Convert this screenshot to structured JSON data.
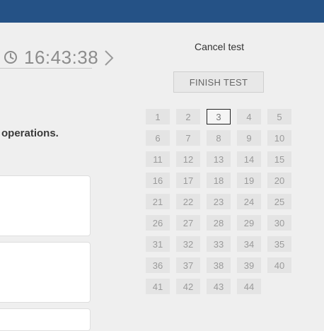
{
  "timer": {
    "time": "16:43:38"
  },
  "question": {
    "text_fragment": "operations."
  },
  "controls": {
    "cancel_label": "Cancel test",
    "finish_label": "FINISH TEST"
  },
  "question_nav": {
    "current": "3",
    "items": [
      "1",
      "2",
      "3",
      "4",
      "5",
      "6",
      "7",
      "8",
      "9",
      "10",
      "11",
      "12",
      "13",
      "14",
      "15",
      "16",
      "17",
      "18",
      "19",
      "20",
      "21",
      "22",
      "23",
      "24",
      "25",
      "26",
      "27",
      "28",
      "29",
      "30",
      "31",
      "32",
      "33",
      "34",
      "35",
      "36",
      "37",
      "38",
      "39",
      "40",
      "41",
      "42",
      "43",
      "44"
    ]
  },
  "colors": {
    "header": "#255286",
    "background": "#efefef",
    "cell": "#e4e4e4",
    "current_border": "#222222"
  },
  "icons": {
    "timer": "clock-icon",
    "next": "chevron-right-icon"
  }
}
